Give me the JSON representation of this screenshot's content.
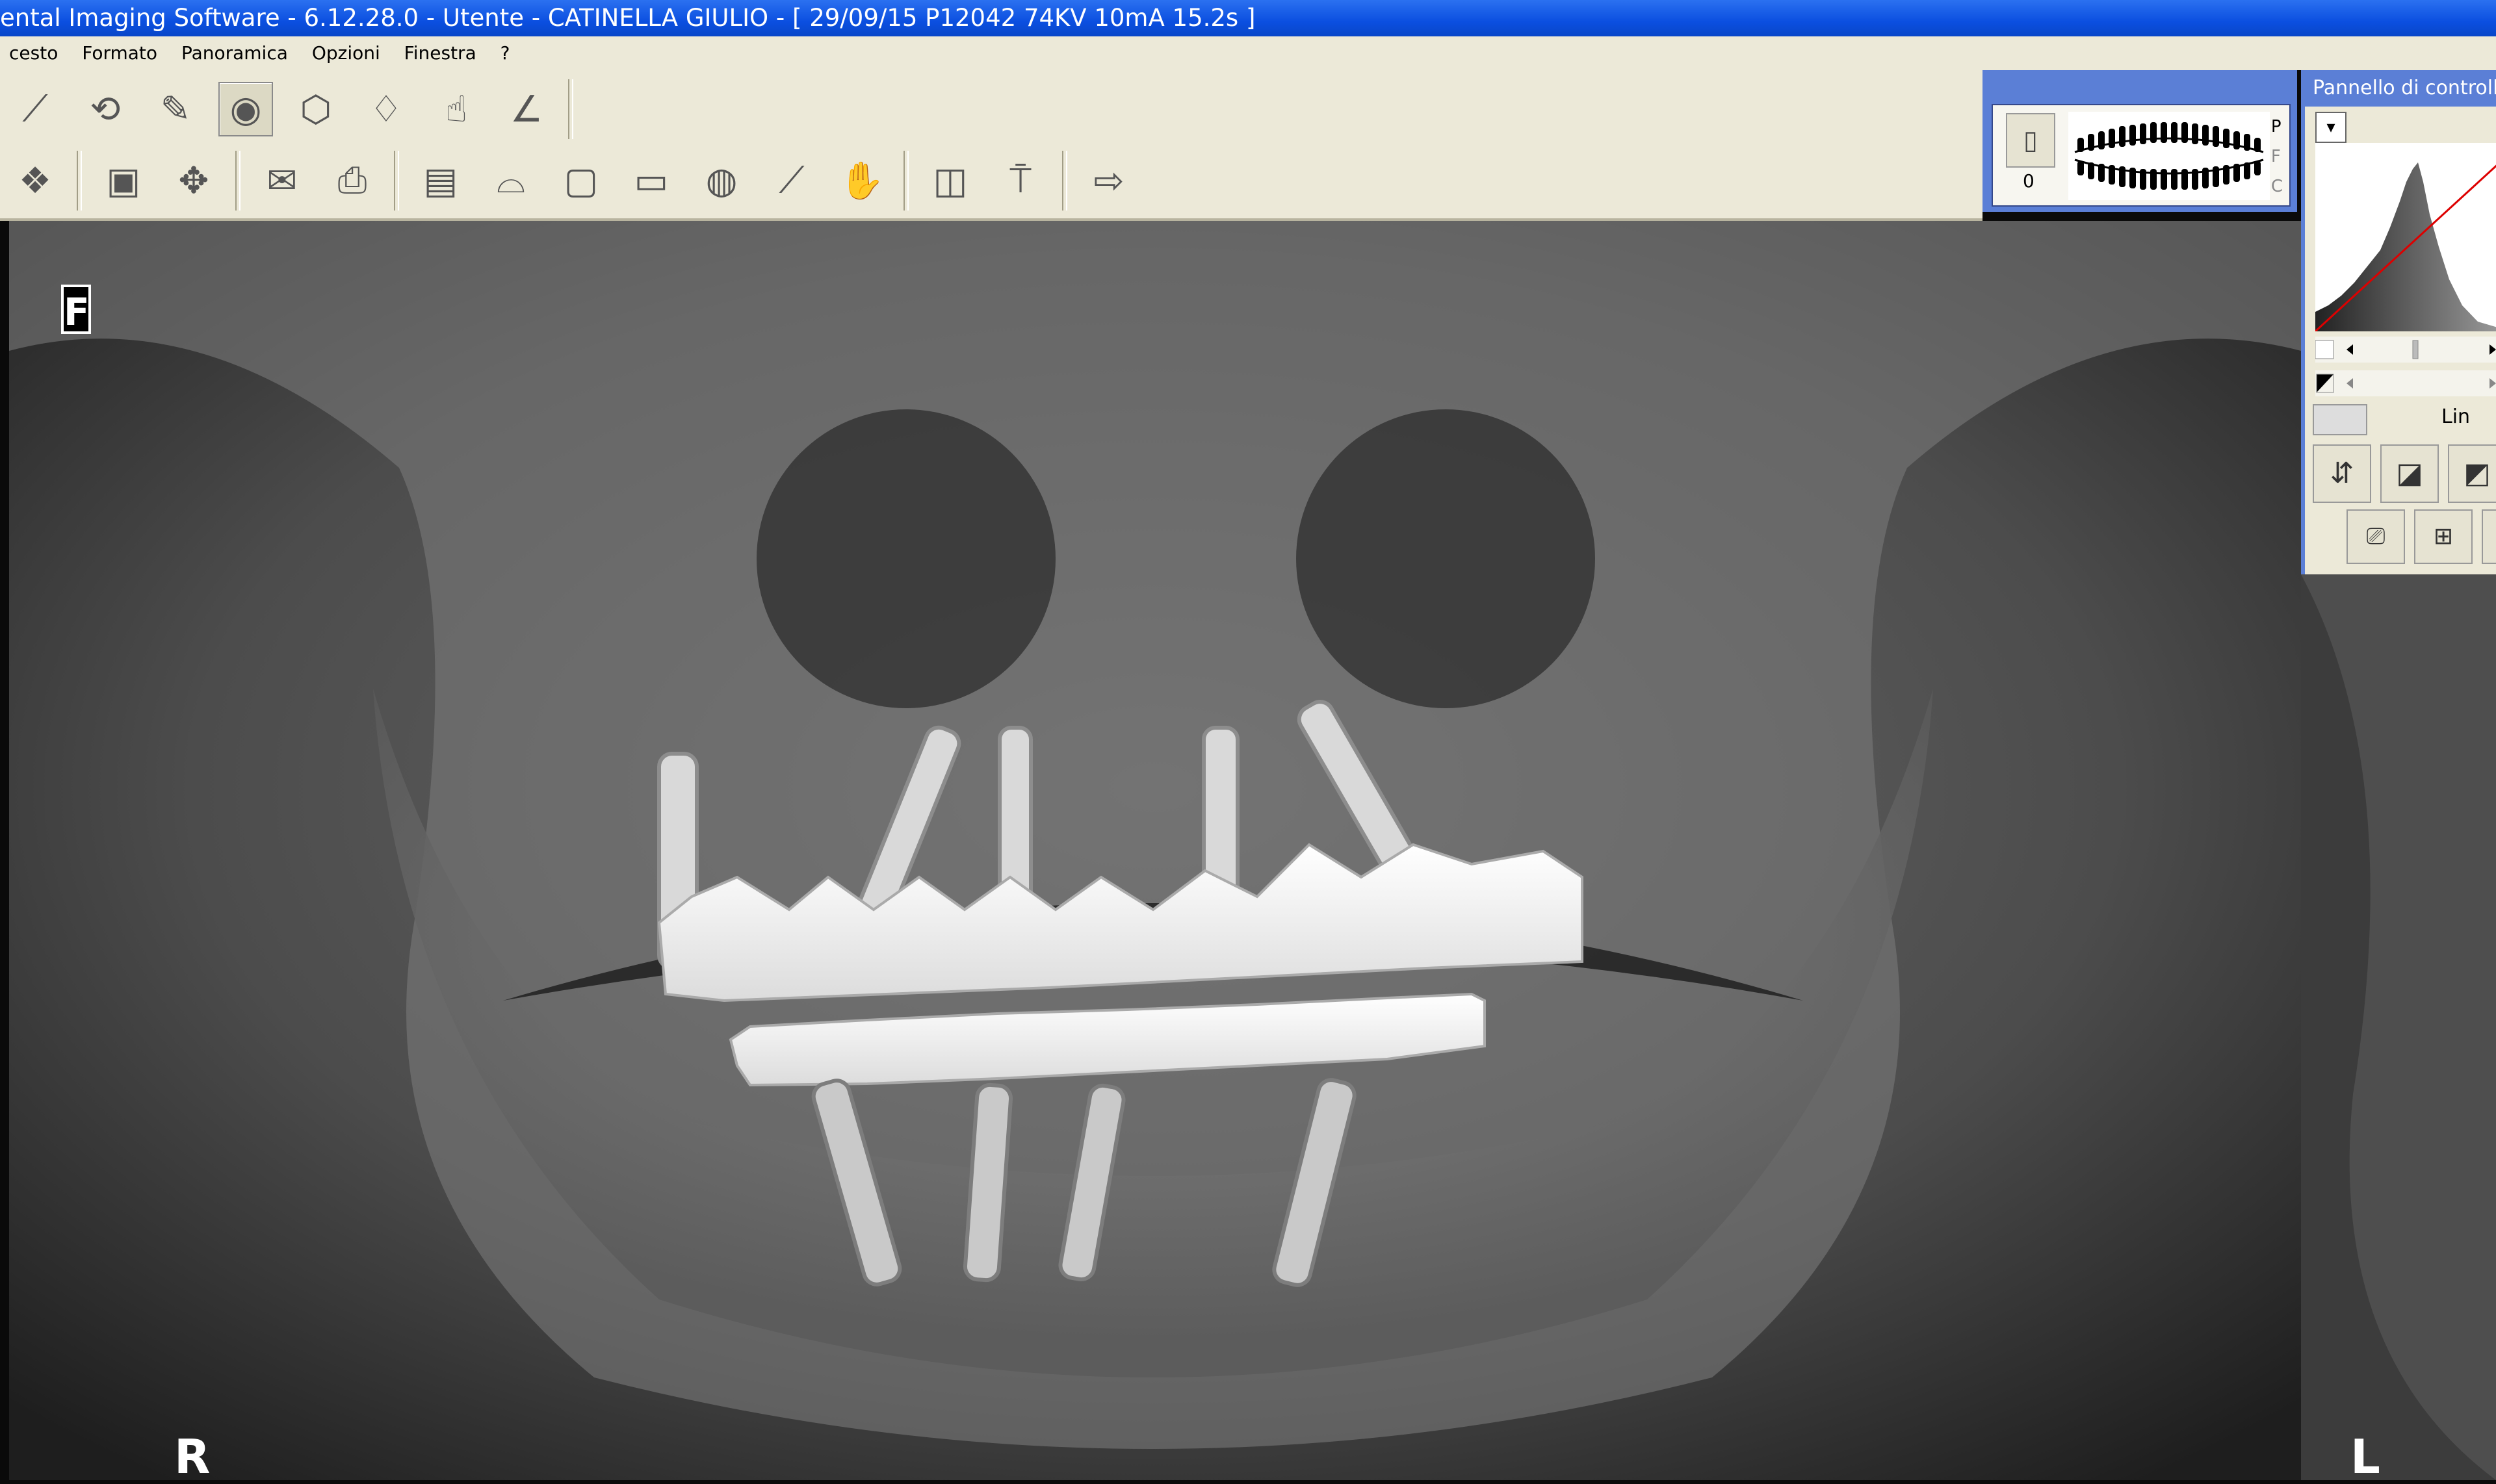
{
  "window": {
    "title": "ental Imaging Software - 6.12.28.0 - Utente  - CATINELLA GIULIO - [ 29/09/15 P12042 74KV 10mA 15.2s ]"
  },
  "menu": {
    "items": [
      "cesto",
      "Formato",
      "Panoramica",
      "Opzioni",
      "Finestra",
      "?"
    ]
  },
  "toolbar": {
    "row1": [
      "brush-icon",
      "rotate-3d-icon",
      "edit-icon",
      "view-eye-icon",
      "cube-icon",
      "tooth-icon",
      "pointer-icon",
      "measure-angle-icon"
    ],
    "row2": [
      "layers-icon",
      "layout-icon",
      "move-icon",
      "envelope-icon",
      "print-icon",
      "film-icon",
      "panoramic-icon",
      "tooth-xray-icon",
      "cassette-icon",
      "cr-icon",
      "ruler-icon",
      "hand-tool-icon",
      "frame-icon",
      "pin-icon",
      "exit-icon"
    ]
  },
  "thumbnail": {
    "count": "0",
    "letters": [
      "P",
      "F",
      "C"
    ]
  },
  "control_panel": {
    "title": "Pannello di controllo",
    "curve_label": "Lin"
  },
  "xray": {
    "orientation_marker": "F",
    "left_label": "R",
    "right_label": "L"
  },
  "colors": {
    "titlebar": "#0b4fe0",
    "menubar": "#ece9d8",
    "panel_frame": "#5b7fd6"
  }
}
